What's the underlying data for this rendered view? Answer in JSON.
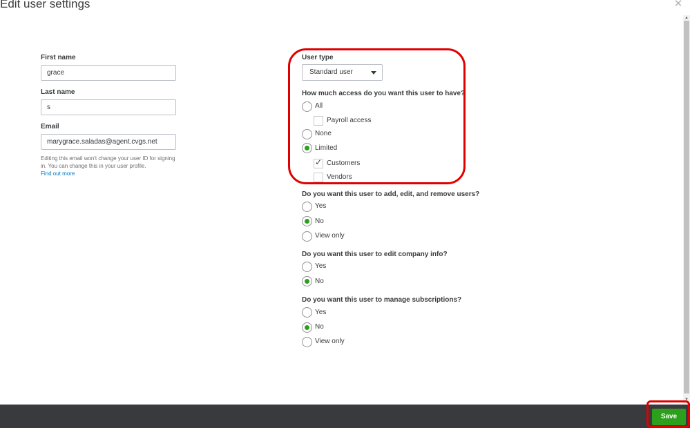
{
  "header": {
    "title": "Edit user settings",
    "close_icon": "close-icon"
  },
  "profile": {
    "first_name_label": "First name",
    "first_name_value": "grace",
    "last_name_label": "Last name",
    "last_name_value": "s",
    "email_label": "Email",
    "email_value": "marygrace.saladas@agent.cvgs.net",
    "email_help": "Editing this email won't change your user ID for signing in. You can change this in your user profile.",
    "find_out_more": "Find out more"
  },
  "user_type": {
    "label": "User type",
    "selected": "Standard user"
  },
  "access": {
    "question": "How much access do you want this user to have?",
    "options": {
      "all": "All",
      "payroll": "Payroll access",
      "none": "None",
      "limited": "Limited",
      "customers": "Customers",
      "vendors": "Vendors"
    },
    "selected": "Limited",
    "customers_checked": true,
    "vendors_checked": false,
    "payroll_checked": false
  },
  "manage_users": {
    "question": "Do you want this user to add, edit, and remove users?",
    "options": [
      "Yes",
      "No",
      "View only"
    ],
    "selected": "No"
  },
  "company_info": {
    "question": "Do you want this user to edit company info?",
    "options": [
      "Yes",
      "No"
    ],
    "selected": "No"
  },
  "subscriptions": {
    "question": "Do you want this user to manage subscriptions?",
    "options": [
      "Yes",
      "No",
      "View only"
    ],
    "selected": "No"
  },
  "footer": {
    "save_label": "Save"
  },
  "colors": {
    "accent_green": "#2ca01c",
    "highlight_red": "#e00000",
    "footer_bg": "#393a3d",
    "link_blue": "#0077c5"
  }
}
